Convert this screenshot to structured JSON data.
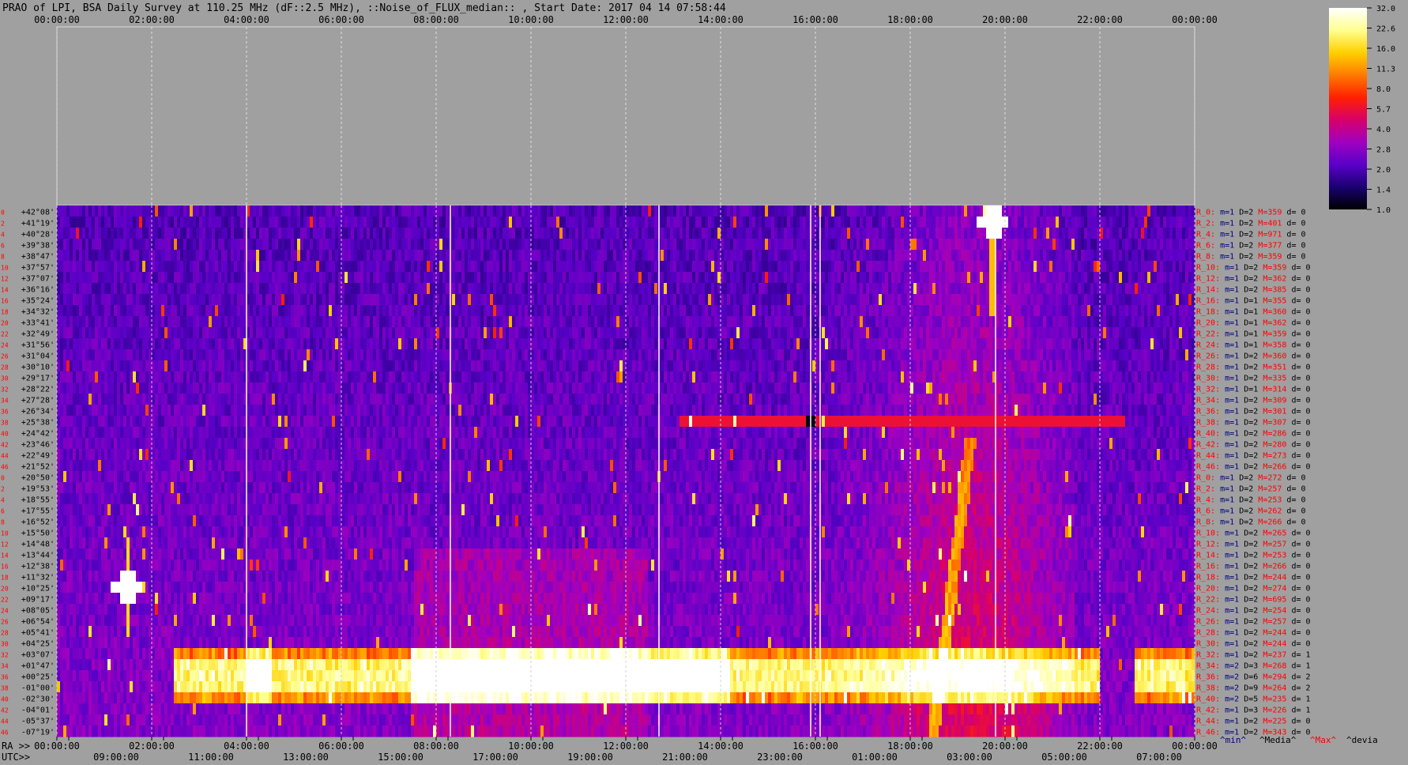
{
  "chart_data": {
    "type": "heatmap",
    "title": "PRAO of LPI, BSA Daily Survey at 110.25 MHz (dF::2.5 MHz), ::Noise_of_FLUX_median:: , Start Date: 2017 04 14 07:58:44",
    "top_time_ticks": [
      "00:00:00",
      "02:00:00",
      "04:00:00",
      "06:00:00",
      "08:00:00",
      "10:00:00",
      "12:00:00",
      "14:00:00",
      "16:00:00",
      "18:00:00",
      "20:00:00",
      "22:00:00",
      "00:00:00"
    ],
    "ra_axis_label": "RA >>",
    "ra_ticks": [
      "00:00:00",
      "02:00:00",
      "04:00:00",
      "06:00:00",
      "08:00:00",
      "10:00:00",
      "12:00:00",
      "14:00:00",
      "16:00:00",
      "18:00:00",
      "20:00:00",
      "22:00:00",
      "00:00:00"
    ],
    "utc_axis_label": "UTC>>",
    "utc_ticks": [
      "09:00:00",
      "11:00:00",
      "13:00:00",
      "15:00:00",
      "17:00:00",
      "19:00:00",
      "21:00:00",
      "23:00:00",
      "01:00:00",
      "03:00:00",
      "05:00:00",
      "07:00:00"
    ],
    "declinations": [
      "+42°08'",
      "+41°19'",
      "+40°28'",
      "+39°38'",
      "+38°47'",
      "+37°57'",
      "+37°07'",
      "+36°16'",
      "+35°24'",
      "+34°32'",
      "+33°41'",
      "+32°49'",
      "+31°56'",
      "+31°04'",
      "+30°10'",
      "+29°17'",
      "+28°22'",
      "+27°28'",
      "+26°34'",
      "+25°38'",
      "+24°42'",
      "+23°46'",
      "+22°49'",
      "+21°52'",
      "+20°50'",
      "+19°53'",
      "+18°55'",
      "+17°55'",
      "+16°52'",
      "+15°50'",
      "+14°48'",
      "+13°44'",
      "+12°38'",
      "+11°32'",
      "+10°25'",
      "+09°17'",
      "+08°05'",
      "+06°54'",
      "+05°41'",
      "+04°25'",
      "+03°07'",
      "+01°47'",
      "+00°25'",
      "-01°00'",
      "-02°30'",
      "-04°01'",
      "-05°37'",
      "-07°19'"
    ],
    "row_indices": [
      "0",
      "2",
      "4",
      "6",
      "8",
      "10",
      "12",
      "14",
      "16",
      "18",
      "20",
      "22",
      "24",
      "26",
      "28",
      "30",
      "32",
      "34",
      "36",
      "38",
      "40",
      "42",
      "44",
      "46",
      "0",
      "2",
      "4",
      "6",
      "8",
      "10",
      "12",
      "14",
      "16",
      "18",
      "20",
      "22",
      "24",
      "26",
      "28",
      "30",
      "32",
      "34",
      "36",
      "38",
      "40",
      "42",
      "44",
      "46"
    ],
    "row_stats": [
      {
        "label": "R_0:",
        "m": "m=1",
        "D": "D=2",
        "M": "M=359",
        "d": "d= 0"
      },
      {
        "label": "R_2:",
        "m": "m=1",
        "D": "D=2",
        "M": "M=401",
        "d": "d= 0"
      },
      {
        "label": "R_4:",
        "m": "m=1",
        "D": "D=2",
        "M": "M=971",
        "d": "d= 0"
      },
      {
        "label": "R_6:",
        "m": "m=1",
        "D": "D=2",
        "M": "M=377",
        "d": "d= 0"
      },
      {
        "label": "R_8:",
        "m": "m=1",
        "D": "D=2",
        "M": "M=359",
        "d": "d= 0"
      },
      {
        "label": "R_10:",
        "m": "m=1",
        "D": "D=2",
        "M": "M=359",
        "d": "d= 0"
      },
      {
        "label": "R_12:",
        "m": "m=1",
        "D": "D=2",
        "M": "M=362",
        "d": "d= 0"
      },
      {
        "label": "R_14:",
        "m": "m=1",
        "D": "D=2",
        "M": "M=385",
        "d": "d= 0"
      },
      {
        "label": "R_16:",
        "m": "m=1",
        "D": "D=1",
        "M": "M=355",
        "d": "d= 0"
      },
      {
        "label": "R_18:",
        "m": "m=1",
        "D": "D=1",
        "M": "M=360",
        "d": "d= 0"
      },
      {
        "label": "R_20:",
        "m": "m=1",
        "D": "D=1",
        "M": "M=362",
        "d": "d= 0"
      },
      {
        "label": "R_22:",
        "m": "m=1",
        "D": "D=1",
        "M": "M=359",
        "d": "d= 0"
      },
      {
        "label": "R_24:",
        "m": "m=1",
        "D": "D=1",
        "M": "M=358",
        "d": "d= 0"
      },
      {
        "label": "R_26:",
        "m": "m=1",
        "D": "D=2",
        "M": "M=360",
        "d": "d= 0"
      },
      {
        "label": "R_28:",
        "m": "m=1",
        "D": "D=2",
        "M": "M=351",
        "d": "d= 0"
      },
      {
        "label": "R_30:",
        "m": "m=1",
        "D": "D=2",
        "M": "M=335",
        "d": "d= 0"
      },
      {
        "label": "R_32:",
        "m": "m=1",
        "D": "D=1",
        "M": "M=314",
        "d": "d= 0"
      },
      {
        "label": "R_34:",
        "m": "m=1",
        "D": "D=2",
        "M": "M=309",
        "d": "d= 0"
      },
      {
        "label": "R_36:",
        "m": "m=1",
        "D": "D=2",
        "M": "M=301",
        "d": "d= 0"
      },
      {
        "label": "R_38:",
        "m": "m=1",
        "D": "D=2",
        "M": "M=307",
        "d": "d= 0"
      },
      {
        "label": "R_40:",
        "m": "m=1",
        "D": "D=2",
        "M": "M=286",
        "d": "d= 0"
      },
      {
        "label": "R_42:",
        "m": "m=1",
        "D": "D=2",
        "M": "M=280",
        "d": "d= 0"
      },
      {
        "label": "R_44:",
        "m": "m=1",
        "D": "D=2",
        "M": "M=273",
        "d": "d= 0"
      },
      {
        "label": "R_46:",
        "m": "m=1",
        "D": "D=2",
        "M": "M=266",
        "d": "d= 0"
      },
      {
        "label": "R_0:",
        "m": "m=1",
        "D": "D=2",
        "M": "M=272",
        "d": "d= 0"
      },
      {
        "label": "R_2:",
        "m": "m=1",
        "D": "D=2",
        "M": "M=257",
        "d": "d= 0"
      },
      {
        "label": "R_4:",
        "m": "m=1",
        "D": "D=2",
        "M": "M=253",
        "d": "d= 0"
      },
      {
        "label": "R_6:",
        "m": "m=1",
        "D": "D=2",
        "M": "M=262",
        "d": "d= 0"
      },
      {
        "label": "R_8:",
        "m": "m=1",
        "D": "D=2",
        "M": "M=266",
        "d": "d= 0"
      },
      {
        "label": "R_10:",
        "m": "m=1",
        "D": "D=2",
        "M": "M=265",
        "d": "d= 0"
      },
      {
        "label": "R_12:",
        "m": "m=1",
        "D": "D=2",
        "M": "M=257",
        "d": "d= 0"
      },
      {
        "label": "R_14:",
        "m": "m=1",
        "D": "D=2",
        "M": "M=253",
        "d": "d= 0"
      },
      {
        "label": "R_16:",
        "m": "m=1",
        "D": "D=2",
        "M": "M=266",
        "d": "d= 0"
      },
      {
        "label": "R_18:",
        "m": "m=1",
        "D": "D=2",
        "M": "M=244",
        "d": "d= 0"
      },
      {
        "label": "R_20:",
        "m": "m=1",
        "D": "D=2",
        "M": "M=274",
        "d": "d= 0"
      },
      {
        "label": "R_22:",
        "m": "m=1",
        "D": "D=2",
        "M": "M=695",
        "d": "d= 0"
      },
      {
        "label": "R_24:",
        "m": "m=1",
        "D": "D=2",
        "M": "M=254",
        "d": "d= 0"
      },
      {
        "label": "R_26:",
        "m": "m=1",
        "D": "D=2",
        "M": "M=257",
        "d": "d= 0"
      },
      {
        "label": "R_28:",
        "m": "m=1",
        "D": "D=2",
        "M": "M=244",
        "d": "d= 0"
      },
      {
        "label": "R_30:",
        "m": "m=1",
        "D": "D=2",
        "M": "M=244",
        "d": "d= 0"
      },
      {
        "label": "R_32:",
        "m": "m=1",
        "D": "D=2",
        "M": "M=237",
        "d": "d= 1"
      },
      {
        "label": "R_34:",
        "m": "m=2",
        "D": "D=3",
        "M": "M=268",
        "d": "d= 1"
      },
      {
        "label": "R_36:",
        "m": "m=2",
        "D": "D=6",
        "M": "M=294",
        "d": "d= 2"
      },
      {
        "label": "R_38:",
        "m": "m=2",
        "D": "D=9",
        "M": "M=264",
        "d": "d= 2"
      },
      {
        "label": "R_40:",
        "m": "m=2",
        "D": "D=5",
        "M": "M=235",
        "d": "d= 1"
      },
      {
        "label": "R_42:",
        "m": "m=1",
        "D": "D=3",
        "M": "M=226",
        "d": "d= 1"
      },
      {
        "label": "R_44:",
        "m": "m=1",
        "D": "D=2",
        "M": "M=225",
        "d": "d= 0"
      },
      {
        "label": "R_46:",
        "m": "m=1",
        "D": "D=2",
        "M": "M=343",
        "d": "d= 0"
      }
    ],
    "stat_legend": {
      "min": "^min^",
      "media": "^Media^",
      "max": "^Max^",
      "devia": "^devia"
    },
    "colorbar_ticks": [
      "32.0",
      "22.6",
      "16.0",
      "11.3",
      "8.0",
      "5.7",
      "4.0",
      "2.8",
      "2.0",
      "1.4",
      "1.0"
    ],
    "colorbar_range": [
      1.0,
      32.0
    ],
    "colorbar_scale": "log",
    "colormap_stops": [
      "#000000",
      "#1a0070",
      "#5a00c8",
      "#a000c0",
      "#d8006a",
      "#ff2000",
      "#ff7a00",
      "#ffd000",
      "#ffff90",
      "#ffffff"
    ],
    "features": {
      "band_dec_range": [
        "+03°07'",
        "-02°30'"
      ],
      "band_ra_segments": [
        [
          "02:30:00",
          "04:00:00"
        ],
        [
          "04:00:00",
          "07:30:00"
        ],
        [
          "07:30:00",
          "14:10:00"
        ],
        [
          "14:10:00",
          "16:00:00"
        ],
        [
          "16:00:00",
          "22:00:00"
        ],
        [
          "22:45:00",
          "24:00:00"
        ]
      ],
      "bright_source_1": {
        "ra": "01:30:00",
        "dec": "+10°25'"
      },
      "bright_source_2": {
        "ra": "19:45:00",
        "dec": "+41°19'"
      },
      "horizontal_line_dec": "+25°38'",
      "horizontal_line_ra": [
        "13:10:00",
        "22:30:00"
      ]
    }
  }
}
